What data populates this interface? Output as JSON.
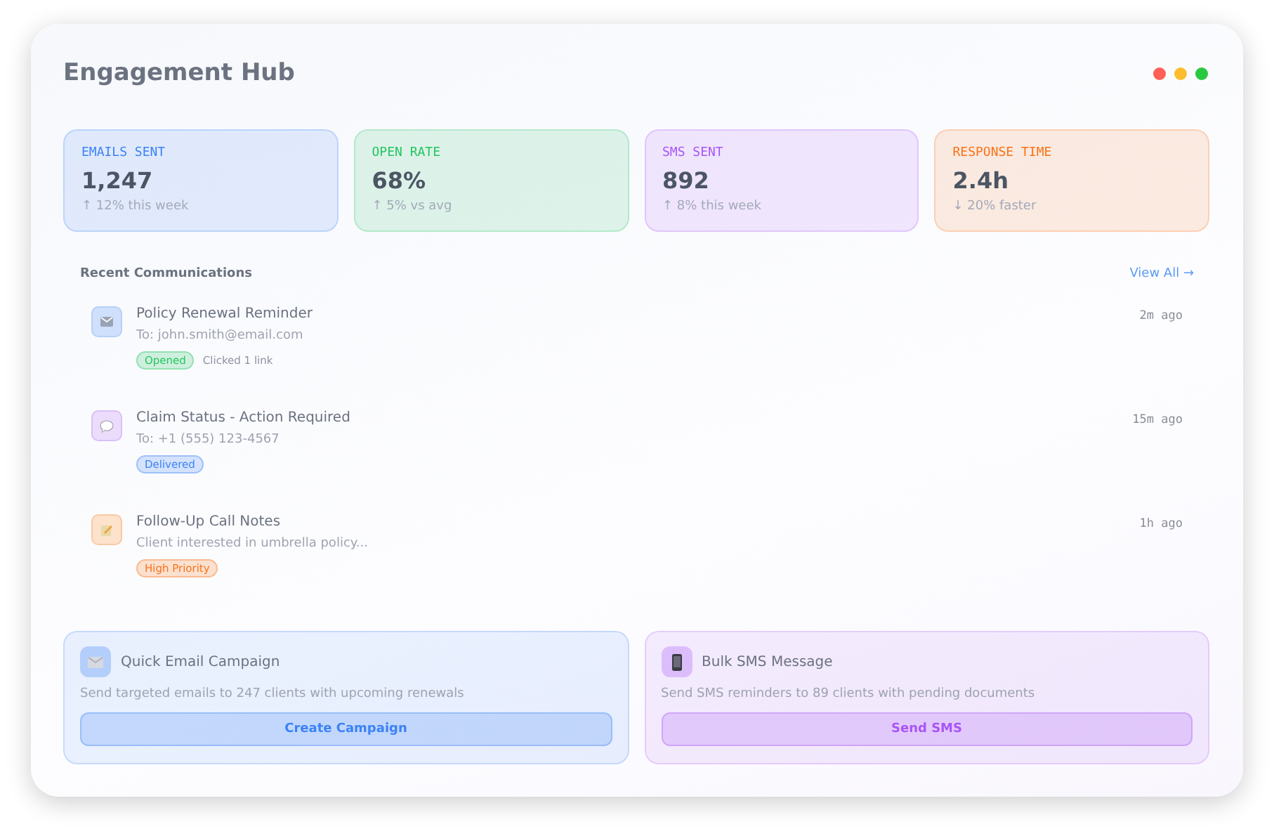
{
  "window": {
    "title": "Engagement Hub",
    "controls": [
      {
        "color": "#ff5f57"
      },
      {
        "color": "#febc2e"
      },
      {
        "color": "#28c840"
      }
    ]
  },
  "stats": [
    {
      "label": "EMAILS SENT",
      "value": "1,247",
      "change": "↑ 12% this week",
      "color": "#3b82f6"
    },
    {
      "label": "OPEN RATE",
      "value": "68%",
      "change": "↑ 5% vs avg",
      "color": "#22c55e"
    },
    {
      "label": "SMS SENT",
      "value": "892",
      "change": "↑ 8% this week",
      "color": "#a855f7"
    },
    {
      "label": "RESPONSE TIME",
      "value": "2.4h",
      "change": "↓ 20% faster",
      "color": "#f97316"
    }
  ],
  "recent": {
    "title": "Recent Communications",
    "link": "View All →",
    "items": [
      {
        "kind": "email",
        "title": "Policy Renewal Reminder",
        "detail": "To: john.smith@email.com",
        "time": "2m ago",
        "tag": {
          "text": "Opened",
          "color": "#22c55e"
        },
        "note": "Clicked 1 link"
      },
      {
        "kind": "sms",
        "title": "Claim Status - Action Required",
        "detail": "To: +1 (555) 123-4567",
        "time": "15m ago",
        "tag": {
          "text": "Delivered",
          "color": "#3b82f6"
        }
      },
      {
        "kind": "note",
        "title": "Follow-Up Call Notes",
        "detail": "Client interested in umbrella policy...",
        "time": "1h ago",
        "tag": {
          "text": "High Priority",
          "color": "#f97316"
        }
      }
    ]
  },
  "actions": [
    {
      "kind": "email",
      "title": "Quick Email Campaign",
      "text": "Send targeted emails to 247 clients with upcoming renewals",
      "button": "Create Campaign",
      "color": "#3b82f6"
    },
    {
      "kind": "sms",
      "title": "Bulk SMS Message",
      "text": "Send SMS reminders to 89 clients with pending documents",
      "button": "Send SMS",
      "color": "#a855f7"
    }
  ]
}
